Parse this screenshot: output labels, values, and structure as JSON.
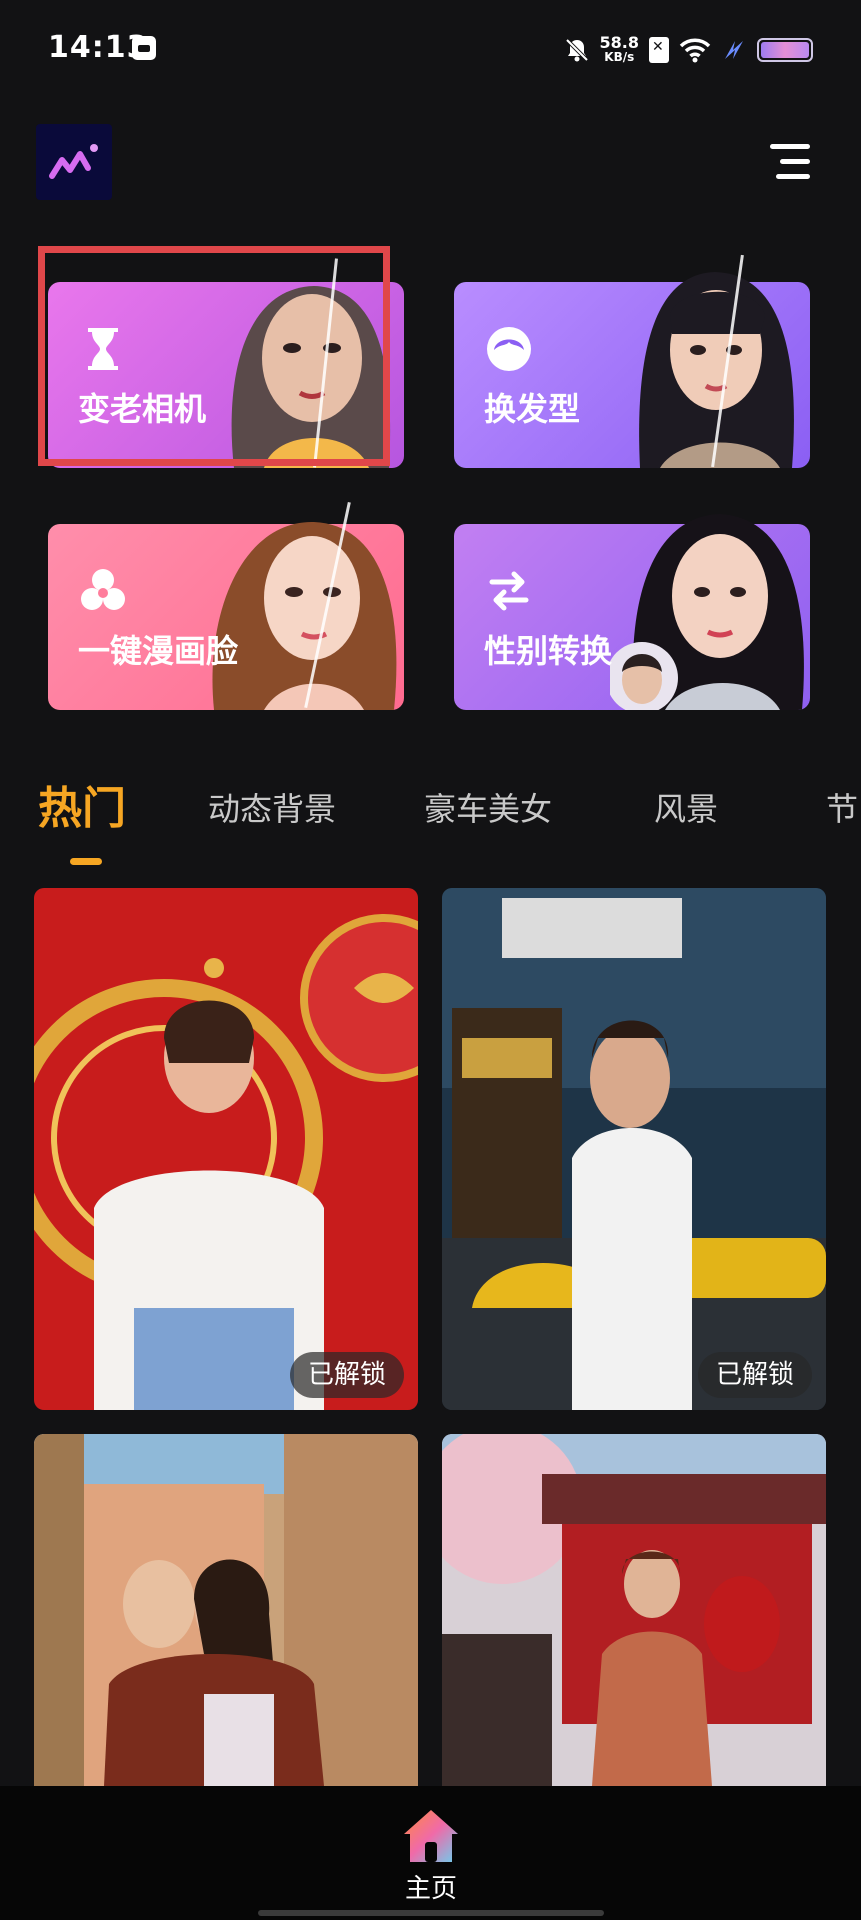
{
  "status_bar": {
    "time": "14:13",
    "net_speed_value": "58.8",
    "net_speed_unit": "KB/s",
    "icons": [
      "calendar-icon",
      "mute-bell-icon",
      "sim-off-icon",
      "wifi-icon",
      "charging-bolt-icon",
      "battery-icon"
    ]
  },
  "header": {
    "logo_icon": "app-logo-icon",
    "menu_icon": "menu-icon"
  },
  "features": [
    {
      "label": "变老相机",
      "icon": "hourglass-icon",
      "colors": [
        "#e070e8",
        "#b05ae0"
      ]
    },
    {
      "label": "换发型",
      "icon": "face-hair-icon",
      "colors": [
        "#b88cff",
        "#8a5cf2"
      ]
    },
    {
      "label": "一键漫画脸",
      "icon": "aperture-icon",
      "colors": [
        "#ff8aa8",
        "#ff6a8e"
      ]
    },
    {
      "label": "性别转换",
      "icon": "swap-arrows-icon",
      "colors": [
        "#c07ef0",
        "#8d5ff0"
      ]
    }
  ],
  "tabs": [
    {
      "label": "热门",
      "active": true
    },
    {
      "label": "动态背景",
      "active": false
    },
    {
      "label": "豪车美女",
      "active": false
    },
    {
      "label": "风景",
      "active": false
    },
    {
      "label": "节",
      "active": false
    }
  ],
  "templates": [
    {
      "badge": "已解锁"
    },
    {
      "badge": "已解锁"
    },
    {
      "badge": ""
    },
    {
      "badge": ""
    }
  ],
  "bottom_nav": {
    "home_label": "主页",
    "home_icon": "home-icon"
  },
  "colors": {
    "background": "#121214",
    "accent": "#f6a623",
    "highlight": "#e0474a"
  }
}
